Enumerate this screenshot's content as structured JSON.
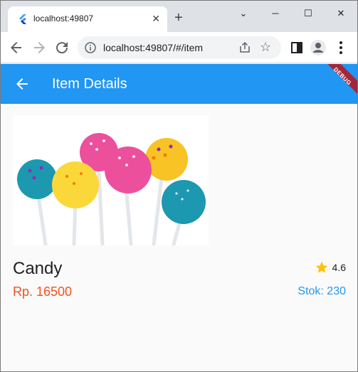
{
  "browser": {
    "tab": {
      "title": "localhost:49807",
      "favicon": "flutter-icon"
    },
    "url": "localhost:49807/#/item",
    "icons": [
      "back-icon",
      "forward-icon",
      "reload-icon",
      "info-icon",
      "share-icon",
      "star-outline-icon",
      "sidebar-icon",
      "profile-icon",
      "menu-icon"
    ]
  },
  "app": {
    "title": "Item Details",
    "debug_banner": "DEBUG",
    "colors": {
      "primary": "#2196f3",
      "price": "#f4511e",
      "stock": "#2196f3",
      "star": "#ffc107",
      "debug": "#a0283a"
    }
  },
  "item": {
    "image": "lollipop-cake-pops-image",
    "name": "Candy",
    "rating": "4.6",
    "price": "Rp. 16500",
    "stock": "Stok: 230"
  }
}
